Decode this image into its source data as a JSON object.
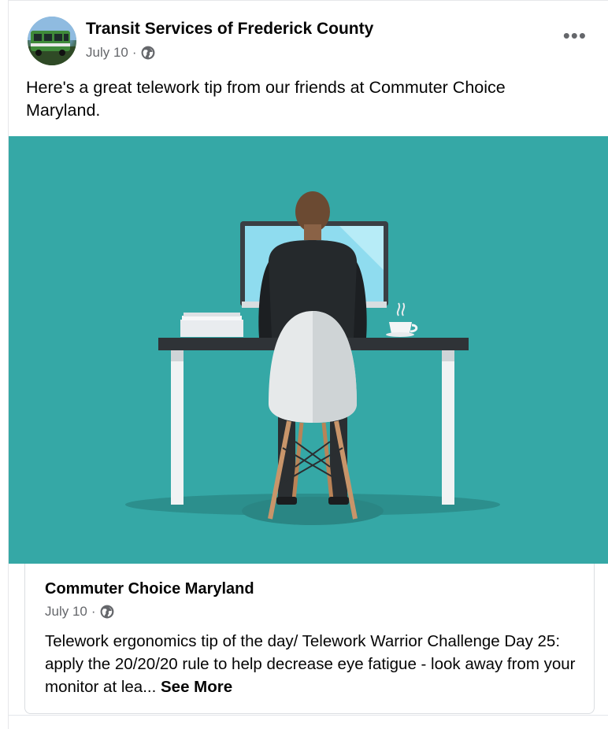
{
  "post": {
    "author": "Transit Services of Frederick County",
    "date": "July 10",
    "separator": " ·",
    "message": "Here's a great telework tip from our friends at Commuter Choice Maryland.",
    "more_label": "•••",
    "audience_icon": "globe-icon"
  },
  "shared": {
    "title": "Commuter Choice Maryland",
    "date": "July 10",
    "separator": " ·",
    "text": "Telework ergonomics tip of the day/ Telework Warrior Challenge Day 25: apply the 20/20/20 rule to help decrease eye fatigue - look away from your monitor at lea...",
    "see_more": "See More"
  },
  "colors": {
    "illustration_bg": "#35a8a6",
    "secondary_text": "#65676b"
  }
}
